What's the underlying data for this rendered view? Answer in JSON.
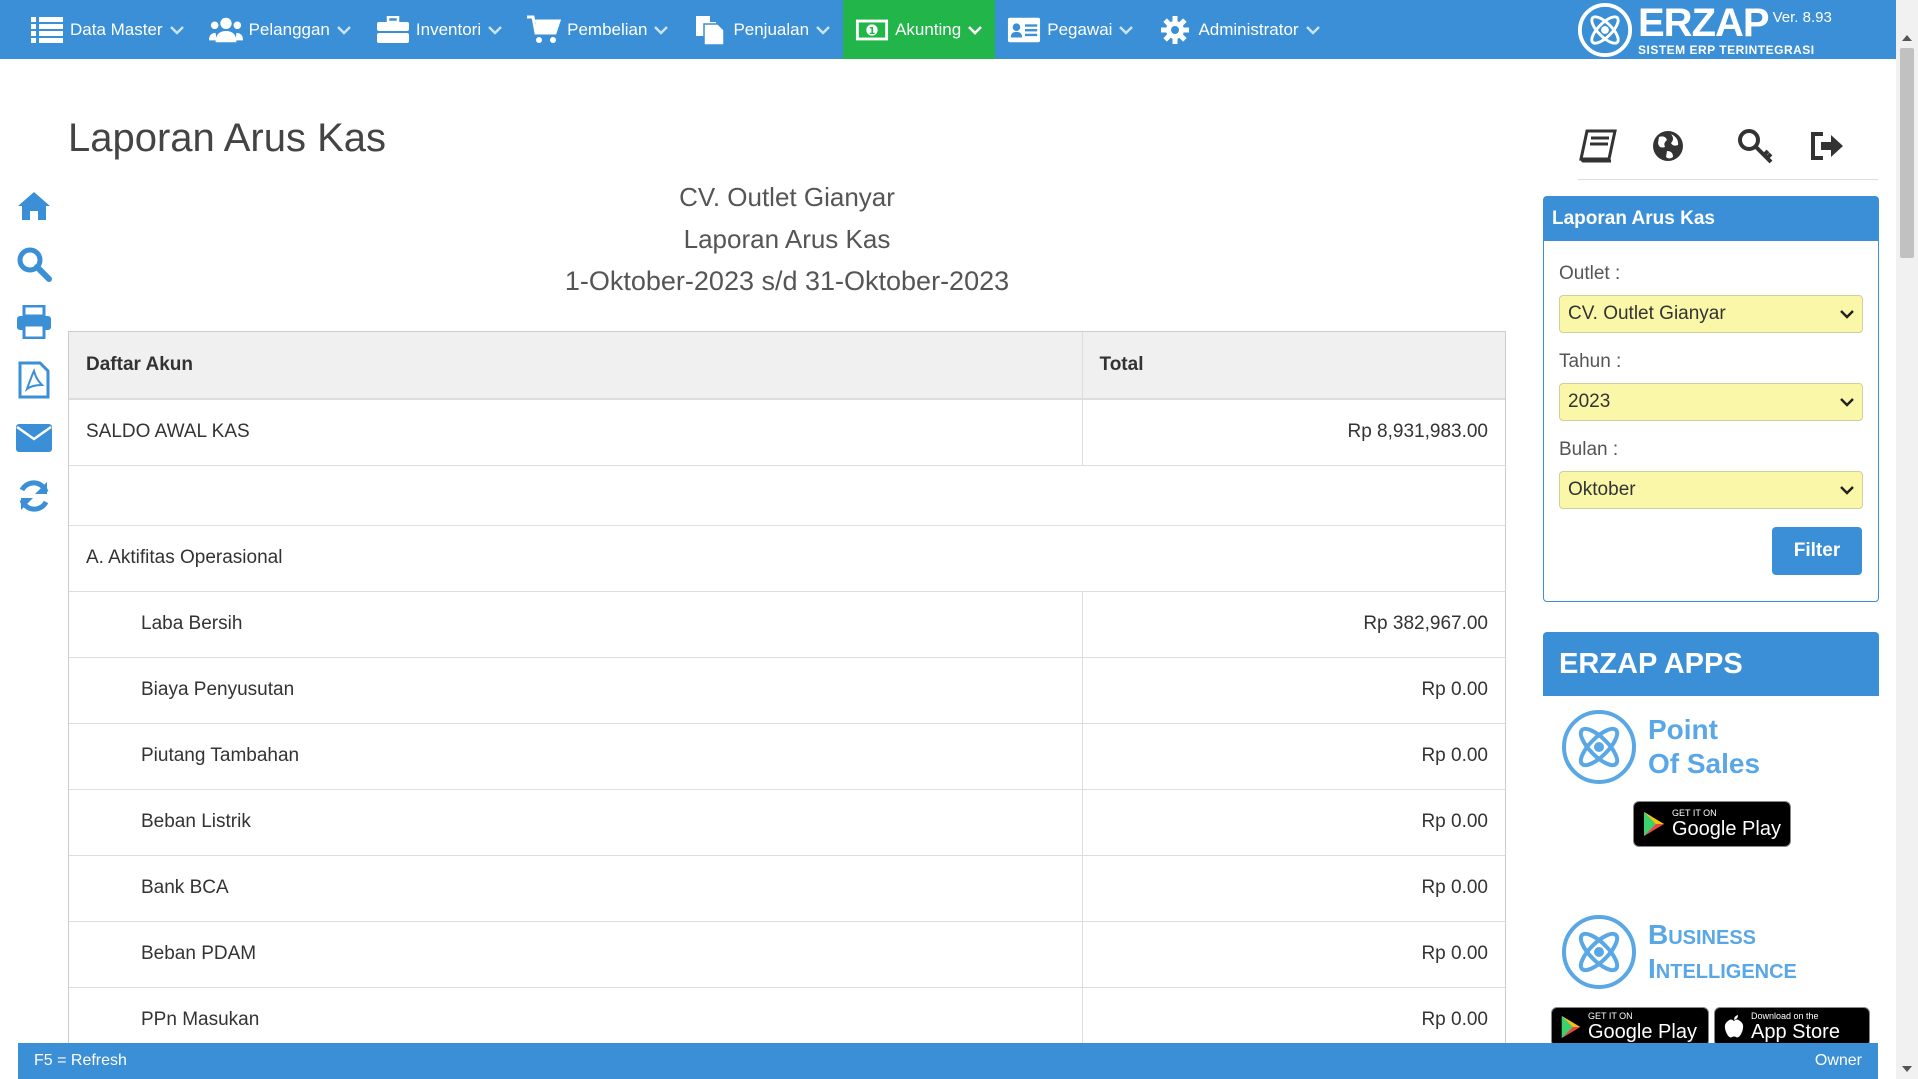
{
  "nav": {
    "items": [
      {
        "label": "Data Master",
        "icon": "list-icon"
      },
      {
        "label": "Pelanggan",
        "icon": "users-icon"
      },
      {
        "label": "Inventori",
        "icon": "briefcase-icon"
      },
      {
        "label": "Pembelian",
        "icon": "cart-icon"
      },
      {
        "label": "Penjualan",
        "icon": "document-icon"
      },
      {
        "label": "Akunting",
        "icon": "money-icon",
        "active": true
      },
      {
        "label": "Pegawai",
        "icon": "id-card-icon"
      },
      {
        "label": "Administrator",
        "icon": "gear-icon"
      }
    ],
    "brand_name": "ERZAP",
    "brand_version": "Ver. 8.93",
    "brand_tagline": "SISTEM ERP TERINTEGRASI"
  },
  "page": {
    "title": "Laporan Arus Kas"
  },
  "report": {
    "company": "CV. Outlet Gianyar",
    "name": "Laporan Arus Kas",
    "period": "1-Oktober-2023 s/d 31-Oktober-2023",
    "columns": {
      "account": "Daftar Akun",
      "total": "Total"
    },
    "opening_label": "SALDO AWAL KAS",
    "opening_value": "Rp 8,931,983.00",
    "section_a": "A. Aktifitas Operasional",
    "rows": [
      {
        "label": "Laba Bersih",
        "value": "Rp 382,967.00"
      },
      {
        "label": "Biaya Penyusutan",
        "value": "Rp 0.00"
      },
      {
        "label": "Piutang Tambahan",
        "value": "Rp 0.00"
      },
      {
        "label": "Beban Listrik",
        "value": "Rp 0.00"
      },
      {
        "label": "Bank BCA",
        "value": "Rp 0.00"
      },
      {
        "label": "Beban PDAM",
        "value": "Rp 0.00"
      },
      {
        "label": "PPn Masukan",
        "value": "Rp 0.00"
      }
    ]
  },
  "filter": {
    "title": "Laporan Arus Kas",
    "outlet_label": "Outlet :",
    "outlet_value": "CV. Outlet Gianyar",
    "year_label": "Tahun :",
    "year_value": "2023",
    "month_label": "Bulan :",
    "month_value": "Oktober",
    "button": "Filter"
  },
  "apps": {
    "title": "ERZAP APPS",
    "pos_line1": "Point",
    "pos_line2": "Of Sales",
    "bi_line1": "Business",
    "bi_line2": "Intelligence",
    "gp_small": "GET IT ON",
    "gp_big": "Google Play",
    "as_small": "Download on the",
    "as_big": "App Store"
  },
  "footer": {
    "left": "F5 = Refresh",
    "right": "Owner"
  },
  "colors": {
    "primary": "#3a8fd6",
    "active_nav": "#22b54a",
    "select_bg": "#fbf7a8"
  }
}
